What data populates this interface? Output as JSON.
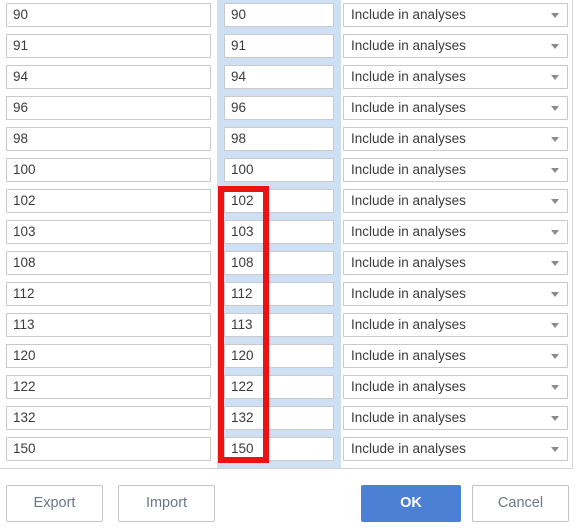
{
  "grid": {
    "column_band_color": "#cfe0f5",
    "select_arrow_icon": "chevron-down-icon",
    "rows": [
      {
        "value_a": "90",
        "value_b": "90",
        "action": "Include in analyses"
      },
      {
        "value_a": "91",
        "value_b": "91",
        "action": "Include in analyses"
      },
      {
        "value_a": "94",
        "value_b": "94",
        "action": "Include in analyses"
      },
      {
        "value_a": "96",
        "value_b": "96",
        "action": "Include in analyses"
      },
      {
        "value_a": "98",
        "value_b": "98",
        "action": "Include in analyses"
      },
      {
        "value_a": "100",
        "value_b": "100",
        "action": "Include in analyses"
      },
      {
        "value_a": "102",
        "value_b": "102",
        "action": "Include in analyses"
      },
      {
        "value_a": "103",
        "value_b": "103",
        "action": "Include in analyses"
      },
      {
        "value_a": "108",
        "value_b": "108",
        "action": "Include in analyses"
      },
      {
        "value_a": "112",
        "value_b": "112",
        "action": "Include in analyses"
      },
      {
        "value_a": "113",
        "value_b": "113",
        "action": "Include in analyses"
      },
      {
        "value_a": "120",
        "value_b": "120",
        "action": "Include in analyses"
      },
      {
        "value_a": "122",
        "value_b": "122",
        "action": "Include in analyses"
      },
      {
        "value_a": "132",
        "value_b": "132",
        "action": "Include in analyses"
      },
      {
        "value_a": "150",
        "value_b": "150",
        "action": "Include in analyses"
      }
    ]
  },
  "annotation": {
    "color": "#ee1111",
    "shape": "rectangle"
  },
  "footer": {
    "export_label": "Export",
    "import_label": "Import",
    "ok_label": "OK",
    "cancel_label": "Cancel",
    "primary_color": "#4b80d4"
  }
}
